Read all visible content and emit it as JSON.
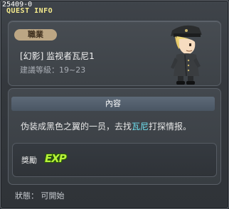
{
  "window": {
    "quest_id": "25409-0",
    "title": "QUEST INFO"
  },
  "quest": {
    "job_badge": "職業",
    "name": "[幻影] 监视者瓦尼1",
    "level_requirement": "建議等級：19~23"
  },
  "content": {
    "header": "內容",
    "description_before": "伪装成黑色之翼的一员，去找",
    "description_highlight": "瓦尼",
    "description_after": "打探情报。"
  },
  "reward": {
    "label": "獎勵",
    "exp_text": "EXP"
  },
  "status": {
    "text": "狀態： 可開始"
  },
  "colors": {
    "title": "#f4ea8c",
    "highlight": "#6fe0f0",
    "exp": "#b8f23a",
    "badge": "#bca684"
  },
  "icons": {
    "character": "black-wing-soldier-sprite",
    "exp": "exp-icon"
  }
}
